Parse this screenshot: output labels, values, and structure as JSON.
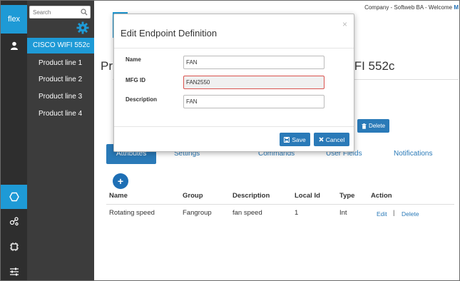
{
  "header": {
    "company_text": "Company - Softweb BA - Welcome",
    "user_initial": "M"
  },
  "rail": {
    "logo": "flex",
    "icons": [
      "user-icon",
      "hexagon-icon",
      "nodes-icon",
      "chip-icon",
      "sliders-icon"
    ]
  },
  "sidebar": {
    "search_placeholder": "Search",
    "items": [
      {
        "label": "CISCO WIFI 552c",
        "active": true
      },
      {
        "label": "Product line 1"
      },
      {
        "label": "Product line 2"
      },
      {
        "label": "Product line 3"
      },
      {
        "label": "Product line 4"
      }
    ]
  },
  "page": {
    "title_left": "Pr",
    "title_right": "IFI 552c",
    "delete_label": "Delete"
  },
  "tabs": [
    "Attributes",
    "Settings",
    "Commands",
    "User Fields",
    "Notifications"
  ],
  "table": {
    "headers": [
      "Name",
      "Group",
      "Description",
      "Local Id",
      "Type",
      "Action"
    ],
    "rows": [
      {
        "name": "Rotating speed",
        "group": "Fangroup",
        "description": "fan speed",
        "local_id": "1",
        "type": "Int",
        "edit": "Edit",
        "sep": "|",
        "delete": "Delete"
      }
    ]
  },
  "modal": {
    "title": "Edit Endpoint Definition",
    "close": "×",
    "fields": [
      {
        "label": "Name",
        "value": "FAN"
      },
      {
        "label": "MFG ID",
        "value": "FAN2550",
        "error": true
      },
      {
        "label": "Description",
        "value": "FAN"
      }
    ],
    "save_label": "Save",
    "cancel_label": "Cancel"
  },
  "colors": {
    "accent": "#1e9ad6",
    "button": "#2a7ab8",
    "sidebar_dark": "#3c3c3c",
    "rail_dark": "#2e2e2e",
    "error_border": "#d9534f"
  }
}
